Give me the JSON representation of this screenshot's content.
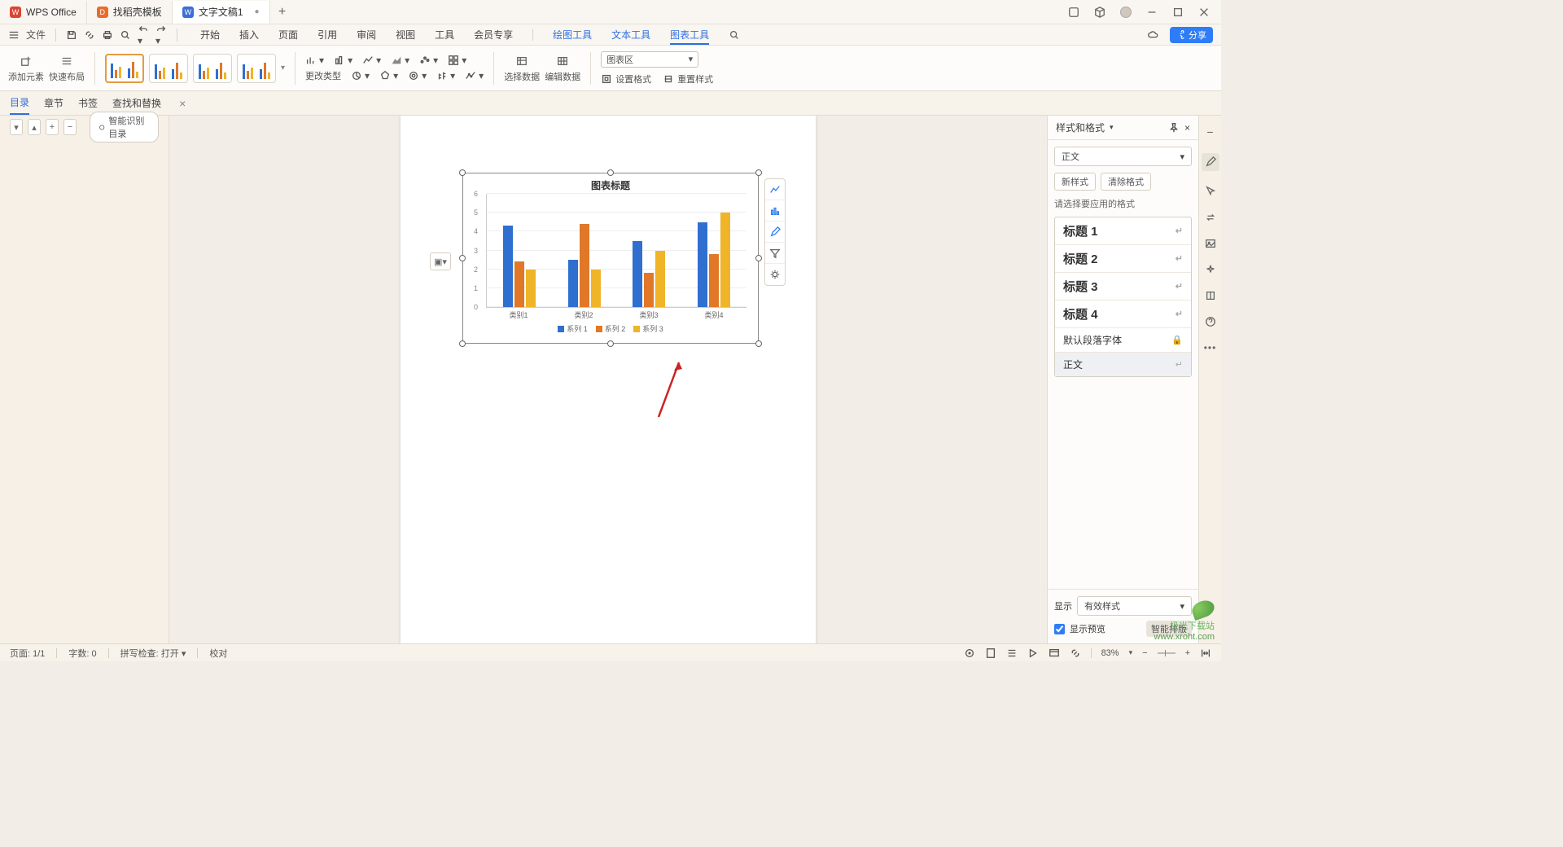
{
  "titlebar": {
    "tabs": [
      {
        "icon": "red",
        "label": "WPS Office"
      },
      {
        "icon": "orange",
        "label": "找稻壳模板"
      },
      {
        "icon": "blue",
        "label": "文字文稿1",
        "active": true,
        "closable": true
      }
    ]
  },
  "menubar": {
    "file": "文件",
    "tabs": [
      "开始",
      "插入",
      "页面",
      "引用",
      "审阅",
      "视图",
      "工具",
      "会员专享"
    ],
    "tool_tabs": [
      "绘图工具",
      "文本工具",
      "图表工具"
    ],
    "active_tool": "图表工具",
    "share": "分享"
  },
  "ribbon": {
    "add_element": "添加元素",
    "quick_layout": "快速布局",
    "change_type": "更改类型",
    "select_data": "选择数据",
    "edit_data": "编辑数据",
    "chart_area_sel": "图表区",
    "set_format": "设置格式",
    "reset_style": "重置样式"
  },
  "subtabs": {
    "items": [
      "目录",
      "章节",
      "书签",
      "查找和替换"
    ],
    "active": "目录",
    "smart_toc": "智能识别目录"
  },
  "styles_panel": {
    "title": "样式和格式",
    "current": "正文",
    "new_style": "新样式",
    "clear_fmt": "清除格式",
    "pick_label": "请选择要应用的格式",
    "items": [
      {
        "label": "标题 1",
        "heading": true
      },
      {
        "label": "标题 2",
        "heading": true
      },
      {
        "label": "标题 3",
        "heading": true
      },
      {
        "label": "标题 4",
        "heading": true
      },
      {
        "label": "默认段落字体",
        "heading": false,
        "lock": true
      },
      {
        "label": "正文",
        "heading": false,
        "selected": true
      }
    ],
    "show_label": "显示",
    "show_value": "有效样式",
    "preview_cb": "显示预览",
    "smart_layout": "智能排版"
  },
  "statusbar": {
    "page": "页面: 1/1",
    "words": "字数: 0",
    "spell": "拼写检查: 打开",
    "proof": "校对",
    "zoom": "83%"
  },
  "chart_data": {
    "type": "bar",
    "title": "图表标题",
    "categories": [
      "类别1",
      "类别2",
      "类别3",
      "类别4"
    ],
    "series": [
      {
        "name": "系列 1",
        "color": "#2f6fd0",
        "values": [
          4.3,
          2.5,
          3.5,
          4.5
        ]
      },
      {
        "name": "系列 2",
        "color": "#e07828",
        "values": [
          2.4,
          4.4,
          1.8,
          2.8
        ]
      },
      {
        "name": "系列 3",
        "color": "#f0b428",
        "values": [
          2.0,
          2.0,
          3.0,
          5.0
        ]
      }
    ],
    "yticks": [
      0,
      1,
      2,
      3,
      4,
      5,
      6
    ],
    "ylim": [
      0,
      6
    ],
    "xlabel": "",
    "ylabel": ""
  },
  "watermark": {
    "line1": "极光下载站",
    "line2": "www.xroht.com"
  }
}
